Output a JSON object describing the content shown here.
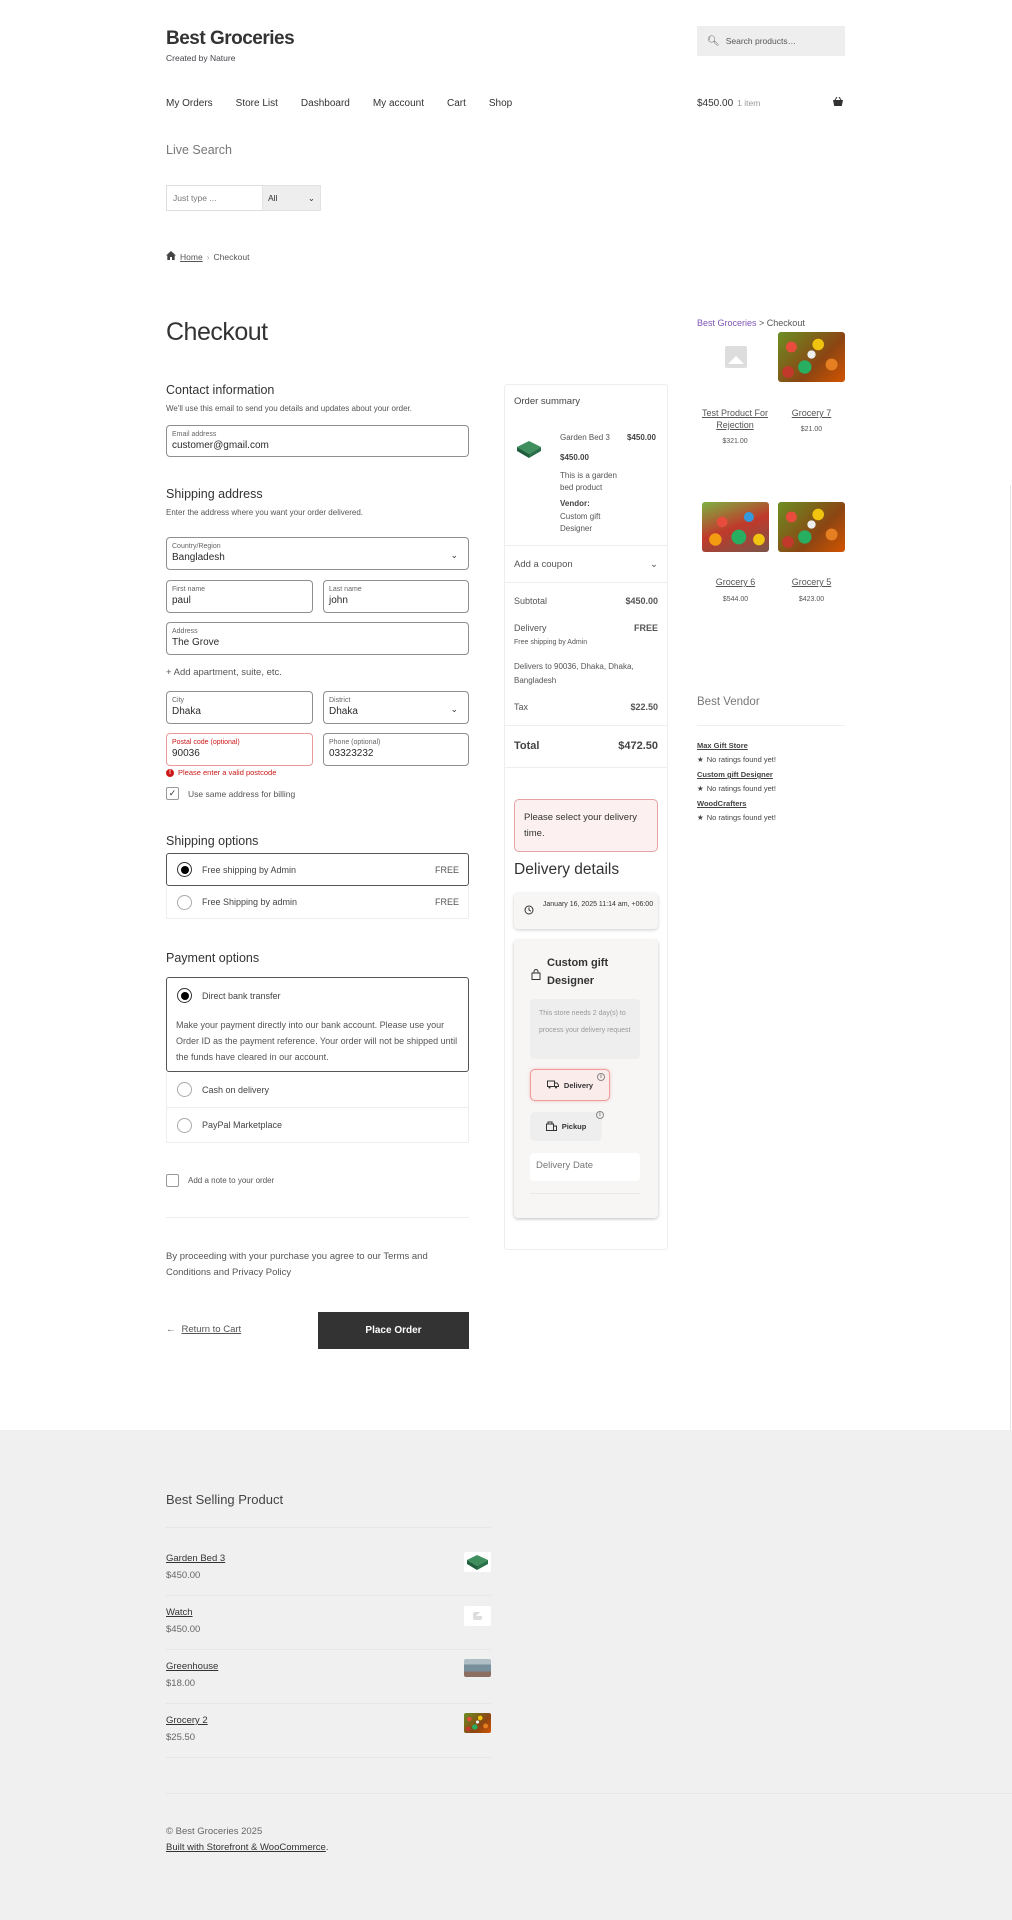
{
  "header": {
    "site_title": "Best Groceries",
    "tagline": "Created by Nature",
    "search_placeholder": "Search products…",
    "nav": [
      "My Orders",
      "Store List",
      "Dashboard",
      "My account",
      "Cart",
      "Shop"
    ],
    "cart_amount": "$450.00",
    "cart_count": "1 item"
  },
  "live_search": {
    "title": "Live Search",
    "input_placeholder": "Just type ...",
    "category_selected": "All"
  },
  "breadcrumb": {
    "home": "Home",
    "separator": "›",
    "current": "Checkout"
  },
  "checkout": {
    "title": "Checkout",
    "contact": {
      "title": "Contact information",
      "subtitle": "We'll use this email to send you details and updates about your order.",
      "email_label": "Email address",
      "email_value": "customer@gmail.com"
    },
    "shipping_address": {
      "title": "Shipping address",
      "subtitle": "Enter the address where you want your order delivered.",
      "country_label": "Country/Region",
      "country_value": "Bangladesh",
      "first_name_label": "First name",
      "first_name_value": "paul",
      "last_name_label": "Last name",
      "last_name_value": "john",
      "address_label": "Address",
      "address_value": "The Grove",
      "add_apartment": "+ Add apartment, suite, etc.",
      "city_label": "City",
      "city_value": "Dhaka",
      "district_label": "District",
      "district_value": "Dhaka",
      "postal_label": "Postal code (optional)",
      "postal_value": "90036",
      "phone_label": "Phone (optional)",
      "phone_value": "03323232",
      "postal_error": "Please enter a valid postcode",
      "same_billing_label": "Use same address for billing",
      "same_billing_checked": true
    },
    "shipping_options": {
      "title": "Shipping options",
      "options": [
        {
          "label": "Free shipping by Admin",
          "price": "FREE",
          "selected": true
        },
        {
          "label": "Free Shipping by admin",
          "price": "FREE",
          "selected": false
        }
      ]
    },
    "payment_options": {
      "title": "Payment options",
      "options": [
        {
          "label": "Direct bank transfer",
          "selected": true,
          "description": "Make your payment directly into our bank account. Please use your Order ID as the payment reference. Your order will not be shipped until the funds have cleared in our account."
        },
        {
          "label": "Cash on delivery",
          "selected": false
        },
        {
          "label": "PayPal Marketplace",
          "selected": false
        }
      ]
    },
    "add_note_label": "Add a note to your order",
    "terms_text": "By proceeding with your purchase you agree to our Terms and Conditions and Privacy Policy",
    "return_label": "Return to Cart",
    "place_order_label": "Place Order"
  },
  "order_summary": {
    "title": "Order summary",
    "item": {
      "name": "Garden Bed 3",
      "line_total": "$450.00",
      "unit_price": "$450.00",
      "description": "This is a garden bed product",
      "vendor_label": "Vendor:",
      "vendor_name": "Custom gift Designer"
    },
    "coupon_label": "Add a coupon",
    "subtotal_label": "Subtotal",
    "subtotal_value": "$450.00",
    "delivery_label": "Delivery",
    "delivery_value": "FREE",
    "delivery_method": "Free shipping by Admin",
    "delivers_to": "Delivers to 90036, Dhaka, Dhaka, Bangladesh",
    "tax_label": "Tax",
    "tax_value": "$22.50",
    "total_label": "Total",
    "total_value": "$472.50"
  },
  "delivery_details": {
    "alert": "Please select your delivery time.",
    "title": "Delivery details",
    "datetime": "January 16, 2025 11:14 am, +06:00",
    "vendor_name": "Custom gift Designer",
    "vendor_note": "This store needs 2 day(s) to process your delivery request",
    "delivery_button": "Delivery",
    "pickup_button": "Pickup",
    "date_placeholder": "Delivery Date"
  },
  "sidebar": {
    "breadcrumb_link": "Best Groceries",
    "breadcrumb_sep": " > ",
    "breadcrumb_current": "Checkout",
    "products": [
      {
        "name": "Test Product For Rejection",
        "price": "$321.00",
        "image": "placeholder"
      },
      {
        "name": "Grocery 7",
        "price": "$21.00",
        "image": "vegetables"
      },
      {
        "name": "Grocery 6",
        "price": "$544.00",
        "image": "vegetables"
      },
      {
        "name": "Grocery 5",
        "price": "$423.00",
        "image": "vegetables"
      }
    ],
    "best_vendor_title": "Best Vendor",
    "vendors": [
      {
        "name": "Max Gift Store",
        "rating": "No ratings found yet!"
      },
      {
        "name": "Custom gift Designer",
        "rating": "No ratings found yet!"
      },
      {
        "name": "WoodCrafters",
        "rating": "No ratings found yet!"
      }
    ]
  },
  "footer": {
    "best_selling_title": "Best Selling Product",
    "best_selling": [
      {
        "name": "Garden Bed 3",
        "price": "$450.00"
      },
      {
        "name": "Watch",
        "price": "$450.00"
      },
      {
        "name": "Greenhouse",
        "price": "$18.00"
      },
      {
        "name": "Grocery 2",
        "price": "$25.50"
      }
    ],
    "copyright": "© Best Groceries 2025",
    "built_with": "Built with Storefront & WooCommerce",
    "built_suffix": "."
  },
  "colors": {
    "accent_link": "#7f54b3",
    "error": "#cc1818",
    "button_dark": "#333333",
    "footer_bg": "#f0f0f0"
  }
}
